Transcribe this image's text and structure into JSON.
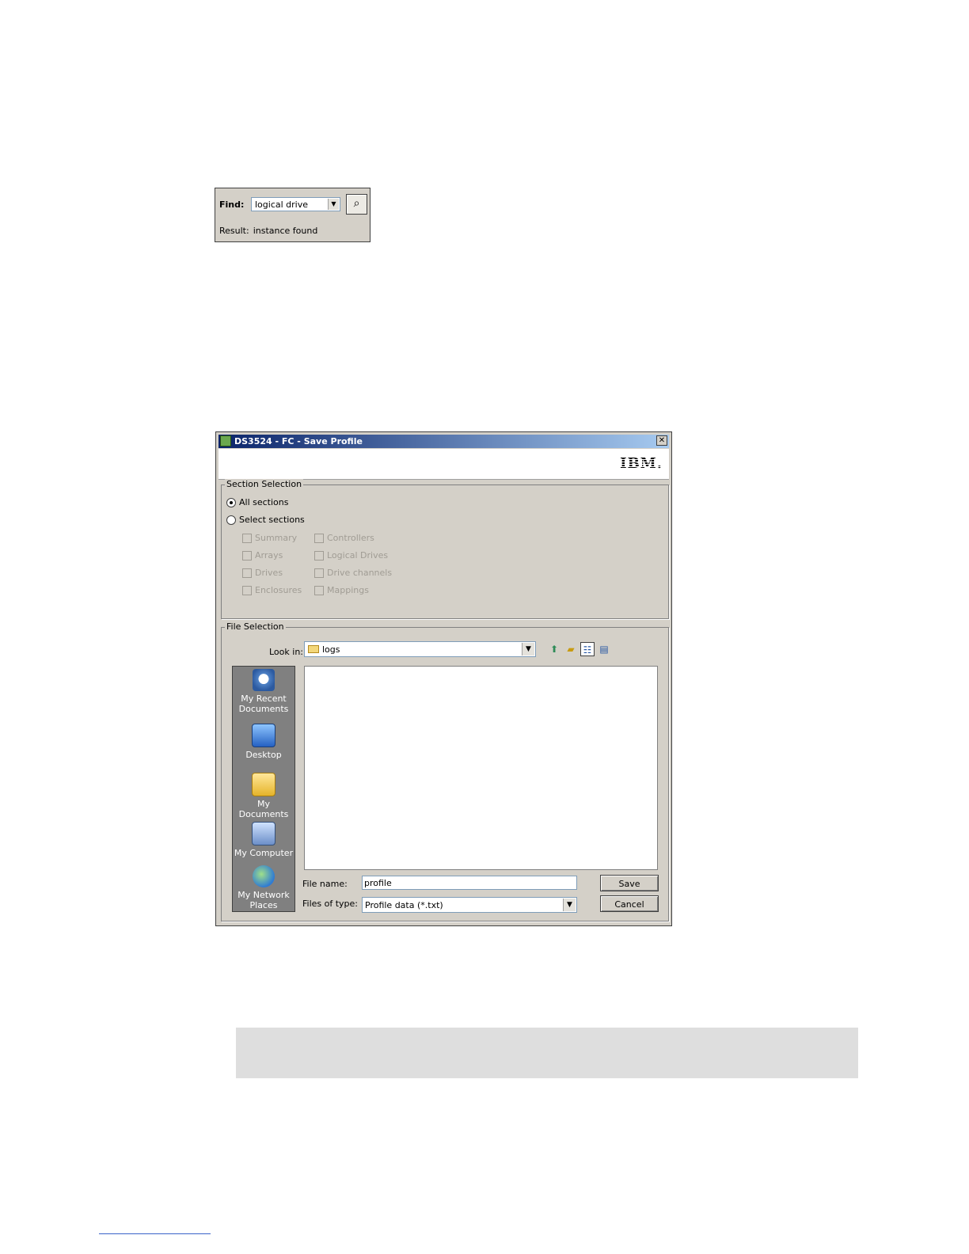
{
  "find_panel": {
    "find_label": "Find:",
    "find_value": "logical drive",
    "result_label": "Result:",
    "result_text": "instance found"
  },
  "dialog": {
    "title": "DS3524 - FC - Save Profile",
    "logo_text": "IBM.",
    "section_selection": {
      "legend": "Section Selection",
      "radio_all": "All sections",
      "radio_select": "Select sections",
      "selected": "All sections",
      "checkboxes_col1": [
        "Summary",
        "Arrays",
        "Drives",
        "Enclosures"
      ],
      "checkboxes_col2": [
        "Controllers",
        "Logical Drives",
        "Drive channels",
        "Mappings"
      ]
    },
    "file_selection": {
      "legend": "File Selection",
      "look_in_label": "Look in:",
      "look_in_value": "logs",
      "places": [
        {
          "label": "My Recent Documents",
          "icon": "recent-documents-icon"
        },
        {
          "label": "Desktop",
          "icon": "desktop-icon"
        },
        {
          "label": "My Documents",
          "icon": "my-documents-icon"
        },
        {
          "label": "My Computer",
          "icon": "my-computer-icon"
        },
        {
          "label": "My Network Places",
          "icon": "network-places-icon"
        }
      ],
      "file_name_label": "File name:",
      "file_name_value": "profile",
      "files_of_type_label": "Files of type:",
      "files_of_type_value": "Profile data (*.txt)",
      "save_label": "Save",
      "cancel_label": "Cancel"
    }
  }
}
